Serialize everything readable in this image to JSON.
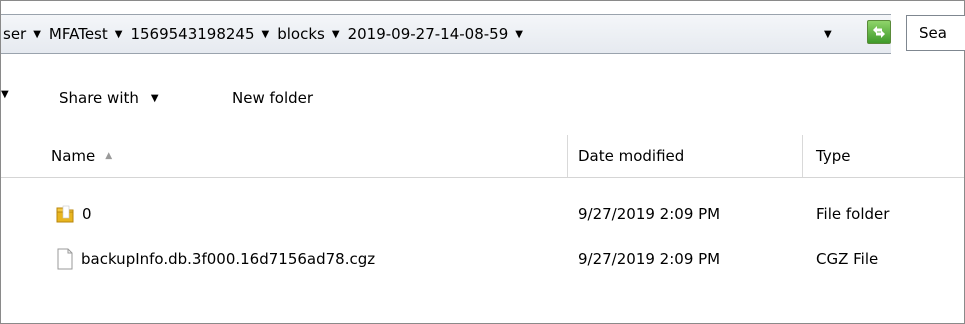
{
  "breadcrumbs": [
    {
      "label": "ser"
    },
    {
      "label": "MFATest"
    },
    {
      "label": "1569543198245"
    },
    {
      "label": "blocks"
    },
    {
      "label": "2019-09-27-14-08-59"
    }
  ],
  "search": {
    "text": "Sea"
  },
  "toolbar": {
    "share_label": "Share with",
    "new_folder_label": "New folder"
  },
  "columns": {
    "name": "Name",
    "date": "Date modified",
    "type": "Type"
  },
  "files": [
    {
      "name": "0",
      "date": "9/27/2019 2:09 PM",
      "type": "File folder",
      "icon": "folder-icon"
    },
    {
      "name": "backupInfo.db.3f000.16d7156ad78.cgz",
      "date": "9/27/2019 2:09 PM",
      "type": "CGZ File",
      "icon": "file-icon"
    }
  ],
  "colors": {
    "refresh_green": "#3f9a2a",
    "folder_yellow": "#e8b520"
  }
}
